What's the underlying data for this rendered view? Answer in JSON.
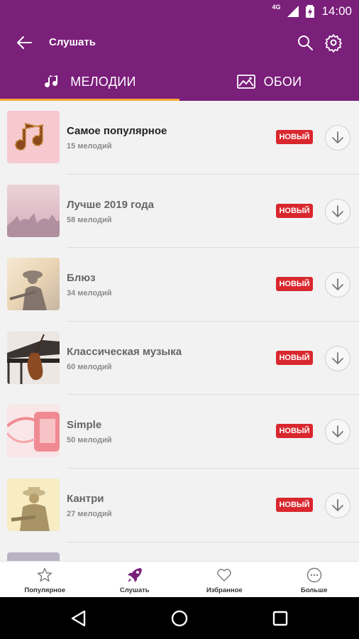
{
  "status_bar": {
    "network": "4G",
    "time": "14:00"
  },
  "app_bar": {
    "title": "Слушать",
    "back_icon": "arrow-left-icon",
    "search_icon": "search-icon",
    "settings_icon": "gear-icon"
  },
  "tabs": [
    {
      "label": "МЕЛОДИИ",
      "icon": "music-note-icon",
      "active": true
    },
    {
      "label": "ОБОИ",
      "icon": "image-icon",
      "active": false
    }
  ],
  "items": [
    {
      "name": "Самое популярное",
      "count": "15 мелодий",
      "badge": "НОВЫЙ"
    },
    {
      "name": "Лучше 2019 года",
      "count": "58 мелодий",
      "badge": "НОВЫЙ"
    },
    {
      "name": "Блюз",
      "count": "34 мелодий",
      "badge": "НОВЫЙ"
    },
    {
      "name": "Классическая музыка",
      "count": "60 мелодий",
      "badge": "НОВЫЙ"
    },
    {
      "name": "Simple",
      "count": "50 мелодий",
      "badge": "НОВЫЙ"
    },
    {
      "name": "Кантри",
      "count": "27 мелодий",
      "badge": "НОВЫЙ"
    }
  ],
  "bottom_nav": [
    {
      "label": "Популярное",
      "icon": "star-icon"
    },
    {
      "label": "Слушать",
      "icon": "rocket-icon",
      "active": true
    },
    {
      "label": "Избранное",
      "icon": "heart-icon"
    },
    {
      "label": "Больше",
      "icon": "more-icon"
    }
  ],
  "colors": {
    "primary": "#7a1f7a",
    "accent": "#f4a93a",
    "badge": "#d9272e"
  }
}
